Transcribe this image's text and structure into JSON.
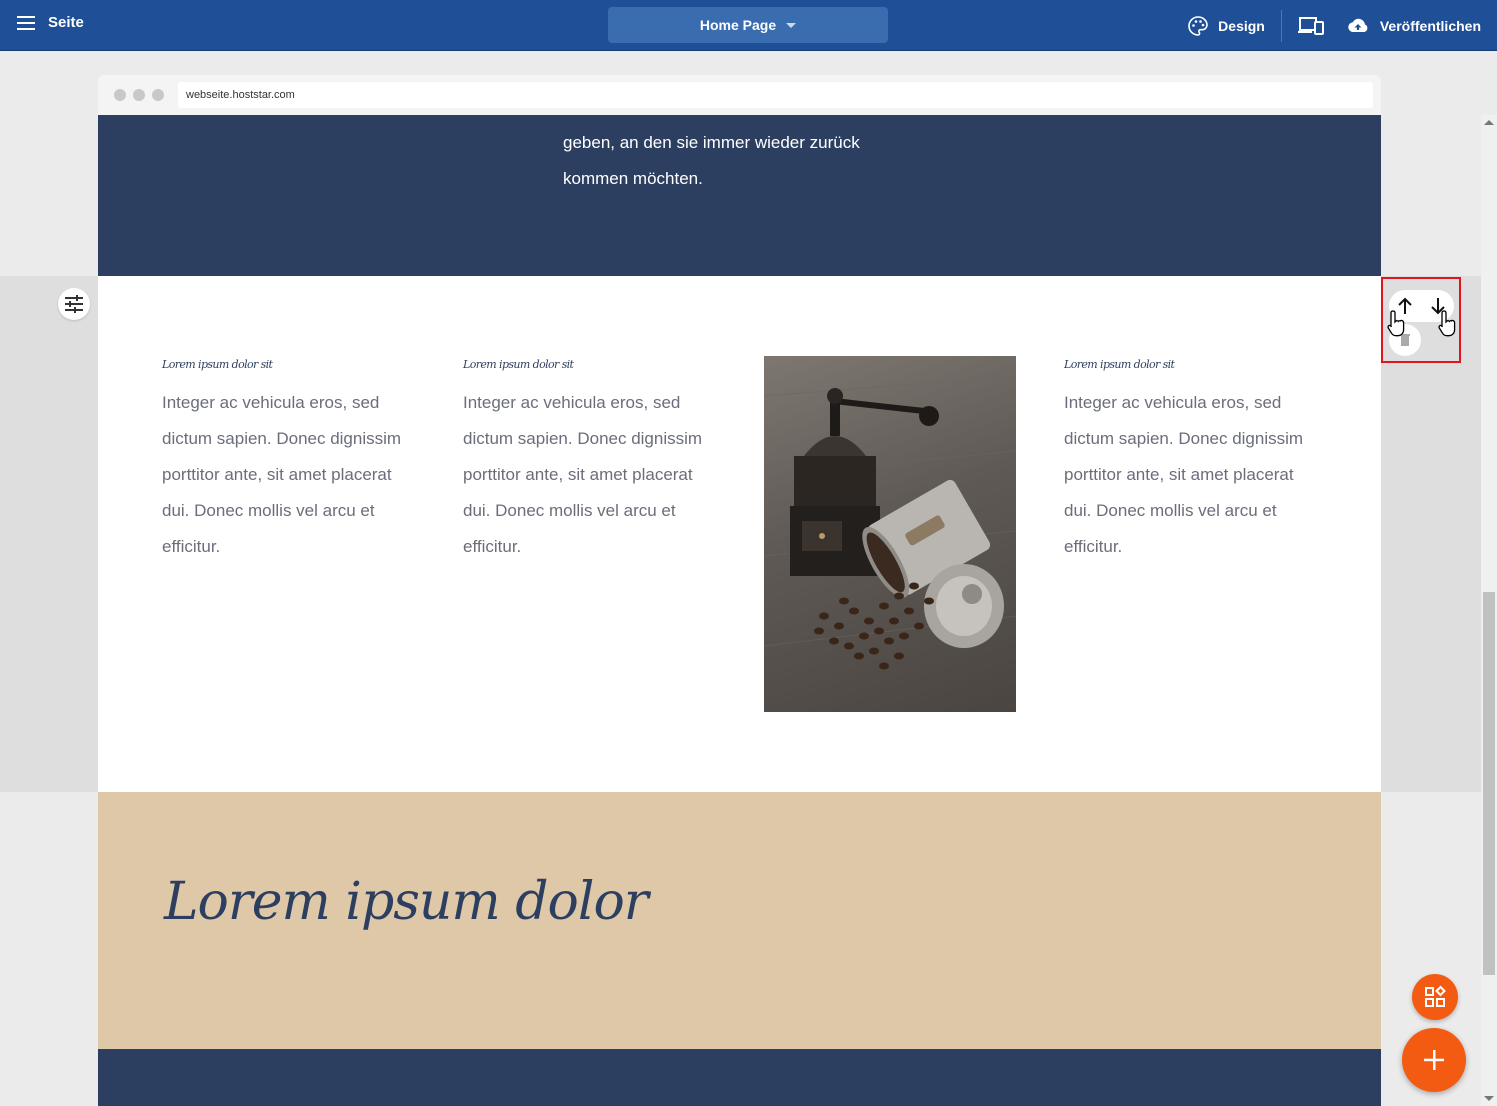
{
  "topbar": {
    "menu_label": "Seite",
    "page_select": "Home Page",
    "design_label": "Design",
    "publish_label": "Veröffentlichen"
  },
  "browser": {
    "url": "webseite.hoststar.com"
  },
  "hero": {
    "line1": "geben, an den sie immer wieder zurück",
    "line2": "kommen möchten."
  },
  "columns": [
    {
      "heading": "Lorem ipsum dolor sit",
      "body": "Integer ac vehicula eros, sed dictum sapien. Donec dignissim porttitor ante, sit amet placerat dui. Donec mollis vel arcu et efficitur."
    },
    {
      "heading": "Lorem ipsum dolor sit",
      "body": "Integer ac vehicula eros, sed dictum sapien. Donec dignissim porttitor ante, sit amet placerat dui. Donec mollis vel arcu et efficitur."
    },
    {
      "heading": "Lorem ipsum dolor sit",
      "body": "Integer ac vehicula eros, sed dictum sapien. Donec dignissim porttitor ante, sit amet placerat dui. Donec mollis vel arcu et efficitur."
    }
  ],
  "beige": {
    "heading": "Lorem ipsum dolor"
  },
  "colors": {
    "topbar": "#1f4f96",
    "dark_section": "#2d3f61",
    "beige_section": "#dfc8a8",
    "accent_orange": "#f45b12",
    "highlight_red": "#e0161d"
  }
}
